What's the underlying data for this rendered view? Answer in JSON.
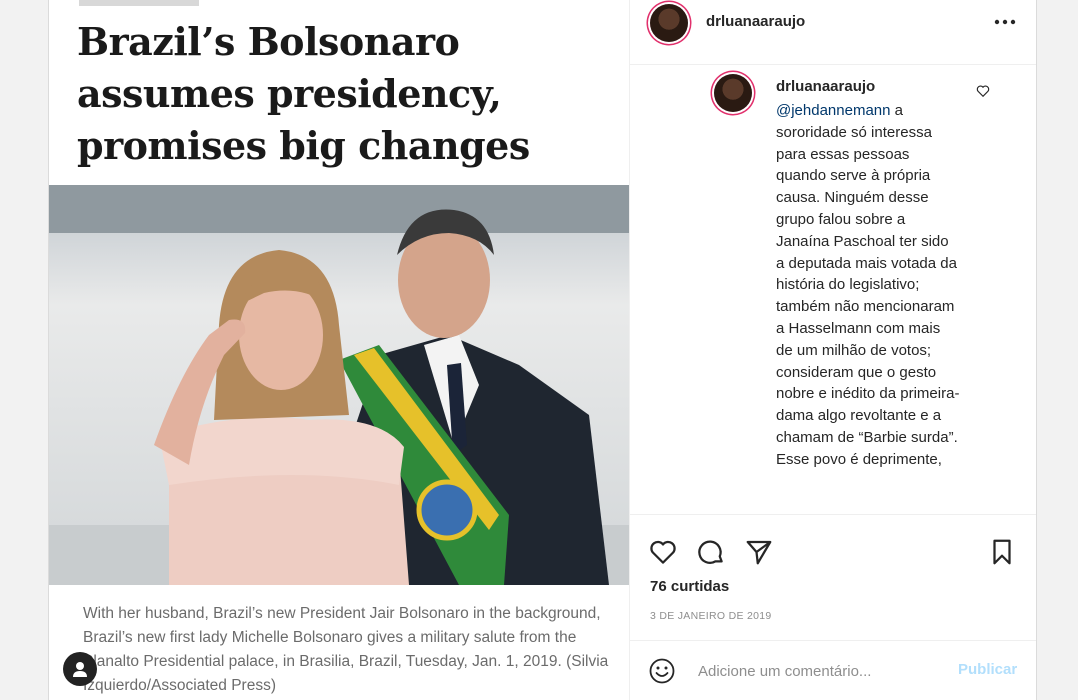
{
  "article": {
    "headline": "Brazil’s Bolsonaro assumes presidency, promises big changes",
    "caption": "With her husband, Brazil’s new President Jair Bolsonaro in the background, Brazil’s new first lady Michelle Bolsonaro gives a military salute from the Planalto Presidential palace, in Brasilia, Brazil, Tuesday, Jan. 1, 2019. (Silvia Izquierdo/Associated Press)"
  },
  "header": {
    "username": "drluanaaraujo",
    "more_icon": "more-horizontal-icon"
  },
  "comment": {
    "username": "drluanaaraujo",
    "mention": "@jehdannemann",
    "text": " a sororidade só interessa para essas pessoas quando serve à própria causa. Ninguém desse grupo falou sobre a Janaína Paschoal ter sido a deputada mais votada da história do legislativo; também não mencionaram a Hasselmann com mais de um milhão de votos; consideram que o gesto nobre e inédito da primeira-dama algo revoltante e a chamam de “Barbie surda”. Esse povo é deprimente,",
    "like_icon": "heart-outline-icon"
  },
  "actions": {
    "icons": [
      "heart-icon",
      "comment-icon",
      "share-icon",
      "bookmark-icon"
    ],
    "likes": "76 curtidas",
    "date": "3 DE JANEIRO DE 2019"
  },
  "comment_bar": {
    "placeholder": "Adicione um comentário...",
    "publish": "Publicar"
  },
  "colors": {
    "mention": "#00376b",
    "publish": "#b2dffc",
    "story_ring": "#e1306c"
  }
}
